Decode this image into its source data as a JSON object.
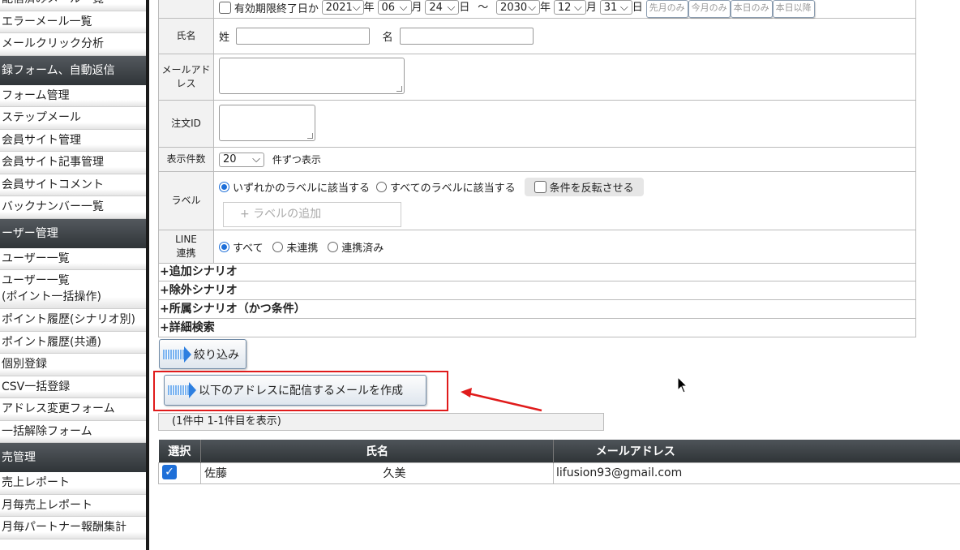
{
  "sidebar": {
    "sections": [
      {
        "type": "item",
        "label": "配信済みメール一覧"
      },
      {
        "type": "item",
        "label": "エラーメール一覧"
      },
      {
        "type": "item",
        "label": "メールクリック分析"
      },
      {
        "type": "head",
        "label": "録フォーム、自動返信"
      },
      {
        "type": "item",
        "label": "フォーム管理"
      },
      {
        "type": "item",
        "label": "ステップメール"
      },
      {
        "type": "item",
        "label": "会員サイト管理"
      },
      {
        "type": "item",
        "label": "会員サイト記事管理"
      },
      {
        "type": "item",
        "label": "会員サイトコメント"
      },
      {
        "type": "item",
        "label": "バックナンバー一覧"
      },
      {
        "type": "head",
        "label": "ーザー管理"
      },
      {
        "type": "item",
        "label": "ユーザー一覧"
      },
      {
        "type": "item2",
        "label": "ユーザー一覧",
        "sub": "(ポイント一括操作)"
      },
      {
        "type": "item",
        "label": "ポイント履歴(シナリオ別)"
      },
      {
        "type": "item",
        "label": "ポイント履歴(共通)"
      },
      {
        "type": "item",
        "label": "個別登録"
      },
      {
        "type": "item",
        "label": "CSV一括登録"
      },
      {
        "type": "item",
        "label": "アドレス変更フォーム"
      },
      {
        "type": "item",
        "label": "一括解除フォーム"
      },
      {
        "type": "head",
        "label": "売管理"
      },
      {
        "type": "item",
        "label": "売上レポート"
      },
      {
        "type": "item",
        "label": "月毎売上レポート"
      },
      {
        "type": "item",
        "label": "月毎パートナー報酬集計"
      }
    ]
  },
  "form": {
    "expiry": {
      "checkbox_label": "有効期限終了日か",
      "from_year": "2021",
      "year_unit": "年",
      "from_month": "06",
      "month_unit": "月",
      "from_day": "24",
      "day_unit": "日",
      "tilde": "～",
      "to_year": "2030",
      "to_month": "12",
      "to_day": "31",
      "btn_last_month": "先月のみ",
      "btn_this_month": "今月のみ",
      "btn_today": "本日のみ",
      "btn_after_today": "本日以降"
    },
    "name": {
      "label": "氏名",
      "last_label": "姓",
      "first_label": "名"
    },
    "email": {
      "label": "メールアドレス"
    },
    "order": {
      "label": "注文ID"
    },
    "per_page": {
      "label": "表示件数",
      "value": "20",
      "suffix": "件ずつ表示"
    },
    "labels": {
      "label": "ラベル",
      "opt_any": "いずれかのラベルに該当する",
      "opt_all": "すべてのラベルに該当する",
      "invert": "条件を反転させる",
      "add": "+ ラベルの追加"
    },
    "line": {
      "label_1": "LINE",
      "label_2": "連携",
      "opt_all": "すべて",
      "opt_unlinked": "未連携",
      "opt_linked": "連携済み"
    },
    "toggles": [
      "+追加シナリオ",
      "+除外シナリオ",
      "+所属シナリオ（かつ条件）",
      "+詳細検索"
    ]
  },
  "buttons": {
    "filter": "絞り込み",
    "create_mail": "以下のアドレスに配信するメールを作成"
  },
  "result_count": "(1件中 1-1件目を表示)",
  "table": {
    "headers": {
      "select": "選択",
      "name": "氏名",
      "email": "メールアドレス"
    },
    "rows": [
      {
        "last": "佐藤",
        "first": "久美",
        "email": "lifusion93@gmail.com",
        "checked": true
      }
    ]
  },
  "colors": {
    "highlight": "#e01b1b",
    "accent": "#1e6fd8",
    "header": "#3a4045"
  }
}
